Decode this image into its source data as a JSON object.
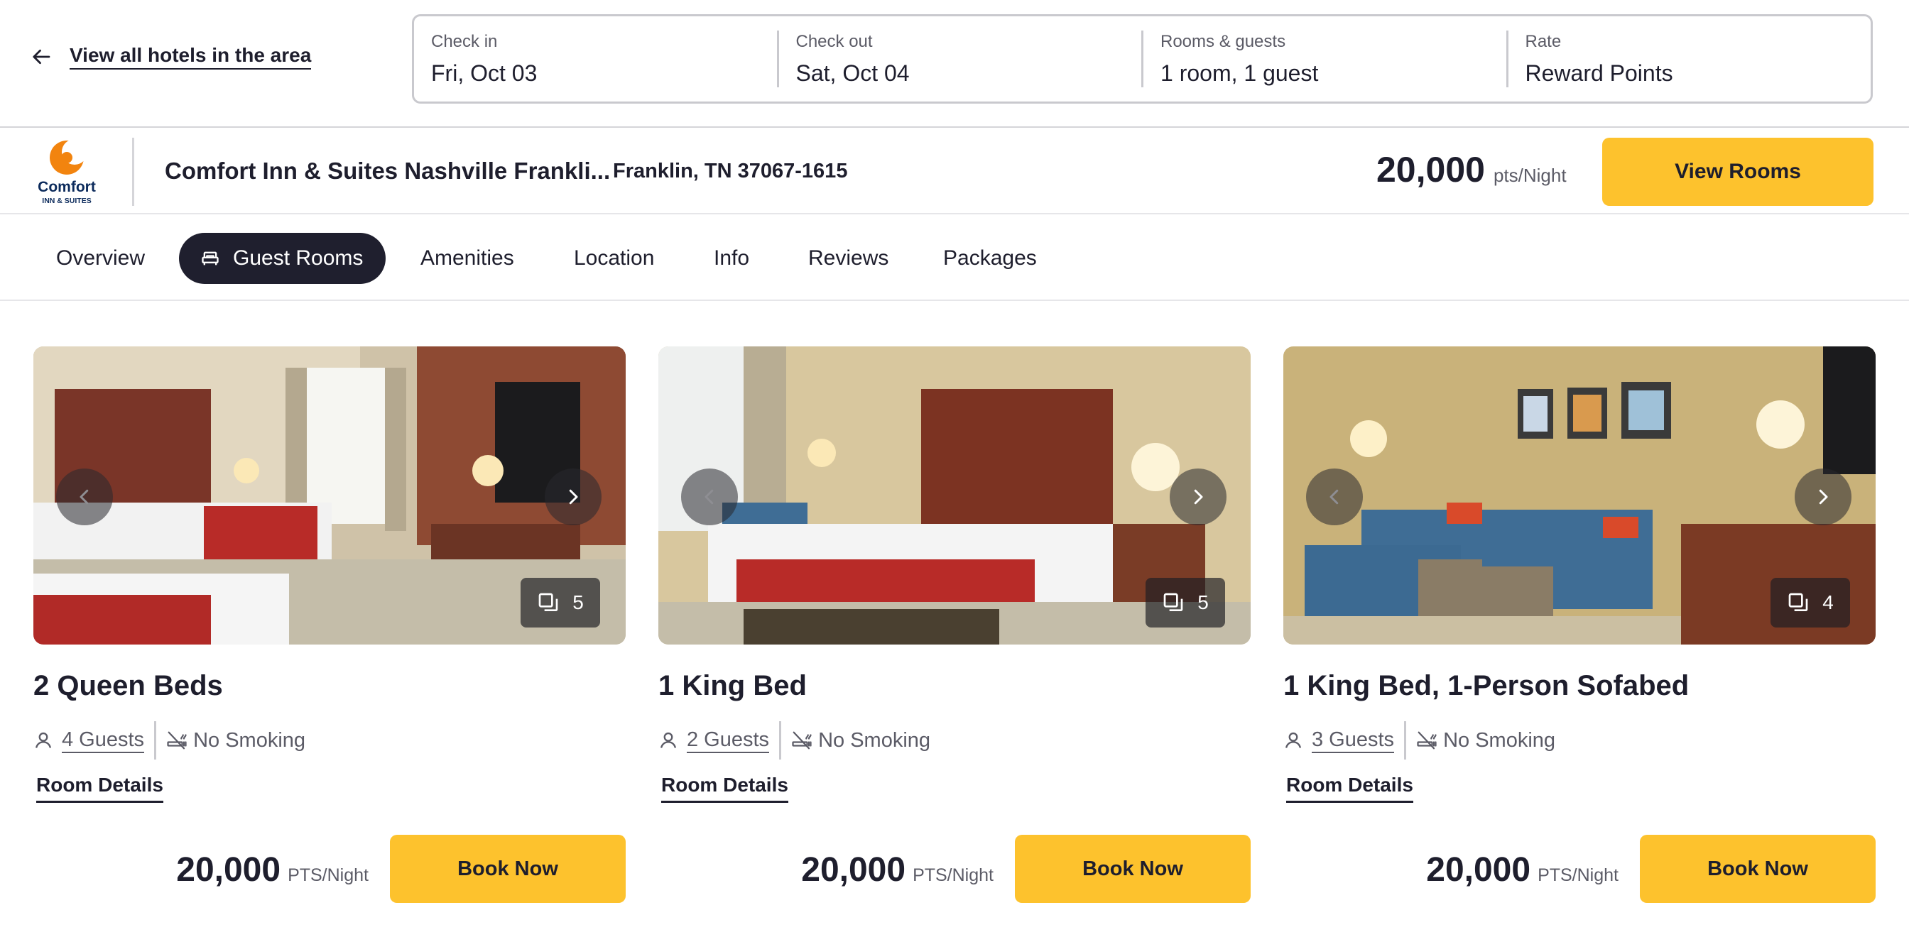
{
  "search": {
    "back_link": "View all hotels in the area",
    "fields": [
      {
        "label": "Check in",
        "value": "Fri, Oct 03"
      },
      {
        "label": "Check out",
        "value": "Sat, Oct 04"
      },
      {
        "label": "Rooms & guests",
        "value": "1 room, 1 guest"
      },
      {
        "label": "Rate",
        "value": "Reward Points"
      }
    ]
  },
  "hotel": {
    "logo_text": "Comfort",
    "logo_subtext": "INN & SUITES",
    "name": "Comfort Inn & Suites Nashville Frankli...",
    "address": "Franklin, TN 37067-1615",
    "price": "20,000",
    "price_unit": "pts/Night",
    "view_rooms_label": "View Rooms"
  },
  "tabs": [
    {
      "label": "Overview",
      "active": false
    },
    {
      "label": "Guest Rooms",
      "active": true,
      "icon": "bed-icon"
    },
    {
      "label": "Amenities",
      "active": false
    },
    {
      "label": "Location",
      "active": false
    },
    {
      "label": "Info",
      "active": false
    },
    {
      "label": "Reviews",
      "active": false
    },
    {
      "label": "Packages",
      "active": false
    }
  ],
  "rooms": [
    {
      "title": "2 Queen Beds",
      "photo_count": "5",
      "guests": "4 Guests",
      "smoking": "No Smoking",
      "details_label": "Room Details",
      "price": "20,000",
      "price_unit": "PTS/Night",
      "book_label": "Book Now"
    },
    {
      "title": "1 King Bed",
      "photo_count": "5",
      "guests": "2 Guests",
      "smoking": "No Smoking",
      "details_label": "Room Details",
      "price": "20,000",
      "price_unit": "PTS/Night",
      "book_label": "Book Now"
    },
    {
      "title": "1 King Bed, 1-Person Sofabed",
      "photo_count": "4",
      "guests": "3 Guests",
      "smoking": "No Smoking",
      "details_label": "Room Details",
      "price": "20,000",
      "price_unit": "PTS/Night",
      "book_label": "Book Now"
    }
  ],
  "colors": {
    "accent_yellow": "#fdc22d",
    "active_tab_bg": "#1f1f2e",
    "text_primary": "#1e1e2d",
    "text_secondary": "#5b5b66",
    "brand_orange": "#f2840f",
    "brand_navy": "#0b2a5b"
  }
}
